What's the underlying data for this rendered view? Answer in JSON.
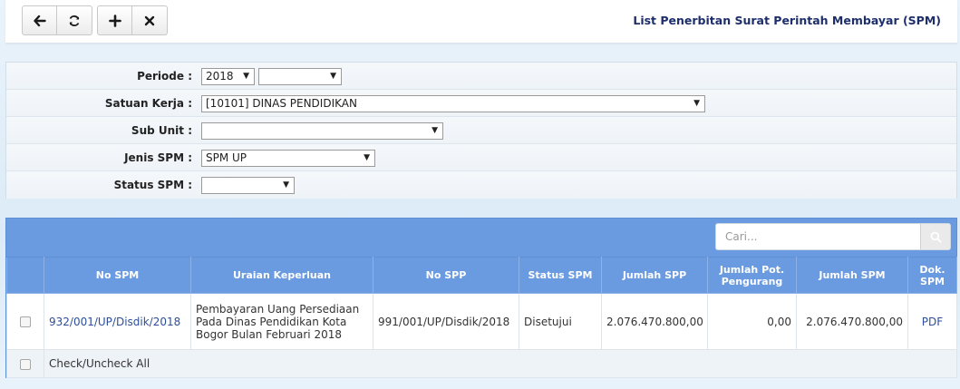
{
  "header": {
    "title": "List Penerbitan Surat Perintah Membayar (SPM)",
    "buttons": {
      "back": "back-arrow-icon",
      "refresh": "refresh-icon",
      "add": "plus-icon",
      "close": "close-icon"
    }
  },
  "filter": {
    "periode_label": "Periode :",
    "periode_year": "2018",
    "periode_month": "",
    "satuan_kerja_label": "Satuan Kerja :",
    "satuan_kerja_value": "[10101] DINAS PENDIDIKAN",
    "sub_unit_label": "Sub Unit :",
    "sub_unit_value": "",
    "jenis_spm_label": "Jenis SPM :",
    "jenis_spm_value": "SPM UP",
    "status_spm_label": "Status SPM :",
    "status_spm_value": ""
  },
  "search": {
    "placeholder": "Cari..."
  },
  "table": {
    "headers": {
      "no_spm": "No SPM",
      "uraian": "Uraian Keperluan",
      "no_spp": "No SPP",
      "status": "Status SPM",
      "jumlah_spp": "Jumlah SPP",
      "jumlah_pot_1": "Jumlah Pot.",
      "jumlah_pot_2": "Pengurang",
      "jumlah_spm": "Jumlah SPM",
      "dok_1": "Dok.",
      "dok_2": "SPM"
    },
    "rows": [
      {
        "no_spm": "932/001/UP/Disdik/2018",
        "uraian_1": "Pembayaran Uang Persediaan",
        "uraian_2": "Pada Dinas Pendidikan Kota",
        "uraian_3": "Bogor Bulan Februari 2018",
        "no_spp": "991/001/UP/Disdik/2018",
        "status": "Disetujui",
        "jumlah_spp": "2.076.470.800,00",
        "jumlah_pot": "0,00",
        "jumlah_spm": "2.076.470.800,00",
        "dok": "PDF"
      }
    ],
    "check_all_label": "Check/Uncheck All"
  }
}
